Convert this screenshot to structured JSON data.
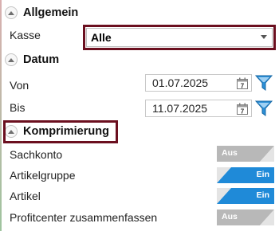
{
  "sections": {
    "allgemein": {
      "title": "Allgemein"
    },
    "datum": {
      "title": "Datum"
    },
    "komprimierung": {
      "title": "Komprimierung"
    }
  },
  "allgemein": {
    "kasse": {
      "label": "Kasse",
      "value": "Alle"
    }
  },
  "datum": {
    "von": {
      "label": "Von",
      "value": "01.07.2025"
    },
    "bis": {
      "label": "Bis",
      "value": "11.07.2025"
    }
  },
  "komprimierung": {
    "sachkonto": {
      "label": "Sachkonto",
      "state": "Aus"
    },
    "artikelgruppe": {
      "label": "Artikelgruppe",
      "state": "Ein"
    },
    "artikel": {
      "label": "Artikel",
      "state": "Ein"
    },
    "profitcenter": {
      "label": "Profitcenter zusammenfassen",
      "state": "Aus"
    }
  },
  "icons": {
    "calendar_day": "7"
  },
  "colors": {
    "highlight_border": "#6b0f1f",
    "toggle_on": "#1f8ad8",
    "toggle_off": "#b8b8b8",
    "filter_icon": "#2b8fd6"
  }
}
